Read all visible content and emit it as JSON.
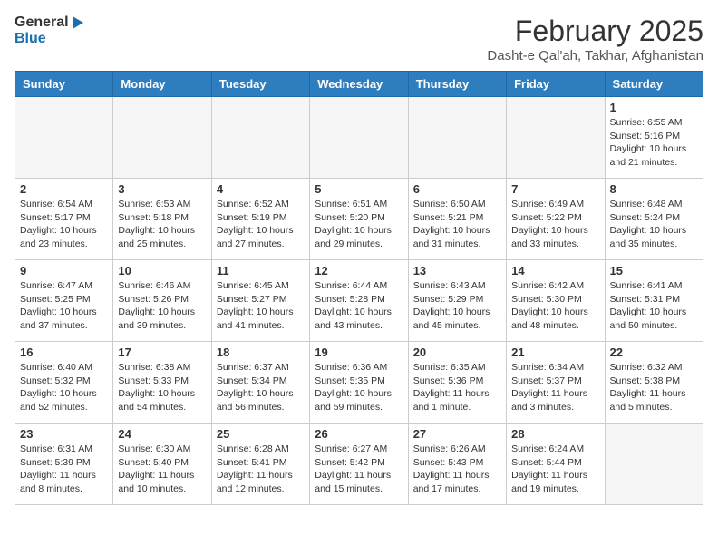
{
  "header": {
    "logo_general": "General",
    "logo_blue": "Blue",
    "title": "February 2025",
    "subtitle": "Dasht-e Qal'ah, Takhar, Afghanistan"
  },
  "calendar": {
    "days_of_week": [
      "Sunday",
      "Monday",
      "Tuesday",
      "Wednesday",
      "Thursday",
      "Friday",
      "Saturday"
    ],
    "weeks": [
      [
        {
          "day": "",
          "info": ""
        },
        {
          "day": "",
          "info": ""
        },
        {
          "day": "",
          "info": ""
        },
        {
          "day": "",
          "info": ""
        },
        {
          "day": "",
          "info": ""
        },
        {
          "day": "",
          "info": ""
        },
        {
          "day": "1",
          "info": "Sunrise: 6:55 AM\nSunset: 5:16 PM\nDaylight: 10 hours\nand 21 minutes."
        }
      ],
      [
        {
          "day": "2",
          "info": "Sunrise: 6:54 AM\nSunset: 5:17 PM\nDaylight: 10 hours\nand 23 minutes."
        },
        {
          "day": "3",
          "info": "Sunrise: 6:53 AM\nSunset: 5:18 PM\nDaylight: 10 hours\nand 25 minutes."
        },
        {
          "day": "4",
          "info": "Sunrise: 6:52 AM\nSunset: 5:19 PM\nDaylight: 10 hours\nand 27 minutes."
        },
        {
          "day": "5",
          "info": "Sunrise: 6:51 AM\nSunset: 5:20 PM\nDaylight: 10 hours\nand 29 minutes."
        },
        {
          "day": "6",
          "info": "Sunrise: 6:50 AM\nSunset: 5:21 PM\nDaylight: 10 hours\nand 31 minutes."
        },
        {
          "day": "7",
          "info": "Sunrise: 6:49 AM\nSunset: 5:22 PM\nDaylight: 10 hours\nand 33 minutes."
        },
        {
          "day": "8",
          "info": "Sunrise: 6:48 AM\nSunset: 5:24 PM\nDaylight: 10 hours\nand 35 minutes."
        }
      ],
      [
        {
          "day": "9",
          "info": "Sunrise: 6:47 AM\nSunset: 5:25 PM\nDaylight: 10 hours\nand 37 minutes."
        },
        {
          "day": "10",
          "info": "Sunrise: 6:46 AM\nSunset: 5:26 PM\nDaylight: 10 hours\nand 39 minutes."
        },
        {
          "day": "11",
          "info": "Sunrise: 6:45 AM\nSunset: 5:27 PM\nDaylight: 10 hours\nand 41 minutes."
        },
        {
          "day": "12",
          "info": "Sunrise: 6:44 AM\nSunset: 5:28 PM\nDaylight: 10 hours\nand 43 minutes."
        },
        {
          "day": "13",
          "info": "Sunrise: 6:43 AM\nSunset: 5:29 PM\nDaylight: 10 hours\nand 45 minutes."
        },
        {
          "day": "14",
          "info": "Sunrise: 6:42 AM\nSunset: 5:30 PM\nDaylight: 10 hours\nand 48 minutes."
        },
        {
          "day": "15",
          "info": "Sunrise: 6:41 AM\nSunset: 5:31 PM\nDaylight: 10 hours\nand 50 minutes."
        }
      ],
      [
        {
          "day": "16",
          "info": "Sunrise: 6:40 AM\nSunset: 5:32 PM\nDaylight: 10 hours\nand 52 minutes."
        },
        {
          "day": "17",
          "info": "Sunrise: 6:38 AM\nSunset: 5:33 PM\nDaylight: 10 hours\nand 54 minutes."
        },
        {
          "day": "18",
          "info": "Sunrise: 6:37 AM\nSunset: 5:34 PM\nDaylight: 10 hours\nand 56 minutes."
        },
        {
          "day": "19",
          "info": "Sunrise: 6:36 AM\nSunset: 5:35 PM\nDaylight: 10 hours\nand 59 minutes."
        },
        {
          "day": "20",
          "info": "Sunrise: 6:35 AM\nSunset: 5:36 PM\nDaylight: 11 hours\nand 1 minute."
        },
        {
          "day": "21",
          "info": "Sunrise: 6:34 AM\nSunset: 5:37 PM\nDaylight: 11 hours\nand 3 minutes."
        },
        {
          "day": "22",
          "info": "Sunrise: 6:32 AM\nSunset: 5:38 PM\nDaylight: 11 hours\nand 5 minutes."
        }
      ],
      [
        {
          "day": "23",
          "info": "Sunrise: 6:31 AM\nSunset: 5:39 PM\nDaylight: 11 hours\nand 8 minutes."
        },
        {
          "day": "24",
          "info": "Sunrise: 6:30 AM\nSunset: 5:40 PM\nDaylight: 11 hours\nand 10 minutes."
        },
        {
          "day": "25",
          "info": "Sunrise: 6:28 AM\nSunset: 5:41 PM\nDaylight: 11 hours\nand 12 minutes."
        },
        {
          "day": "26",
          "info": "Sunrise: 6:27 AM\nSunset: 5:42 PM\nDaylight: 11 hours\nand 15 minutes."
        },
        {
          "day": "27",
          "info": "Sunrise: 6:26 AM\nSunset: 5:43 PM\nDaylight: 11 hours\nand 17 minutes."
        },
        {
          "day": "28",
          "info": "Sunrise: 6:24 AM\nSunset: 5:44 PM\nDaylight: 11 hours\nand 19 minutes."
        },
        {
          "day": "",
          "info": ""
        }
      ]
    ]
  }
}
